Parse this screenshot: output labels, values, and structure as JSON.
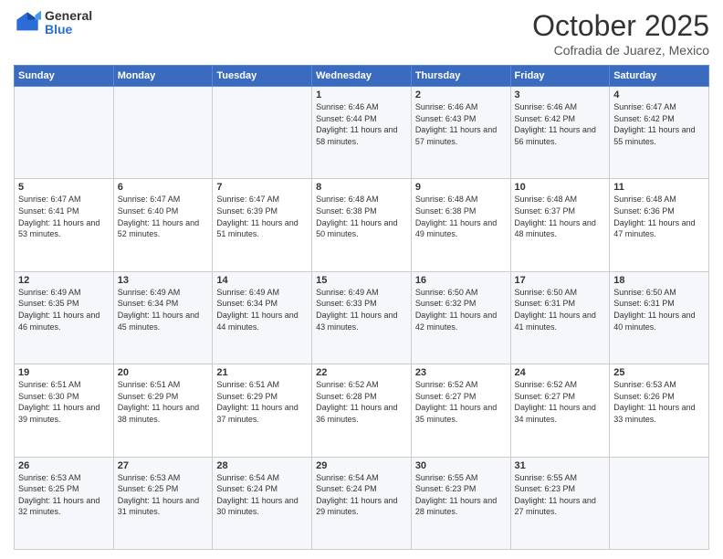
{
  "header": {
    "logo_general": "General",
    "logo_blue": "Blue",
    "month_title": "October 2025",
    "location": "Cofradia de Juarez, Mexico"
  },
  "days_of_week": [
    "Sunday",
    "Monday",
    "Tuesday",
    "Wednesday",
    "Thursday",
    "Friday",
    "Saturday"
  ],
  "weeks": [
    [
      {
        "day": "",
        "sunrise": "",
        "sunset": "",
        "daylight": ""
      },
      {
        "day": "",
        "sunrise": "",
        "sunset": "",
        "daylight": ""
      },
      {
        "day": "",
        "sunrise": "",
        "sunset": "",
        "daylight": ""
      },
      {
        "day": "1",
        "sunrise": "Sunrise: 6:46 AM",
        "sunset": "Sunset: 6:44 PM",
        "daylight": "Daylight: 11 hours and 58 minutes."
      },
      {
        "day": "2",
        "sunrise": "Sunrise: 6:46 AM",
        "sunset": "Sunset: 6:43 PM",
        "daylight": "Daylight: 11 hours and 57 minutes."
      },
      {
        "day": "3",
        "sunrise": "Sunrise: 6:46 AM",
        "sunset": "Sunset: 6:42 PM",
        "daylight": "Daylight: 11 hours and 56 minutes."
      },
      {
        "day": "4",
        "sunrise": "Sunrise: 6:47 AM",
        "sunset": "Sunset: 6:42 PM",
        "daylight": "Daylight: 11 hours and 55 minutes."
      }
    ],
    [
      {
        "day": "5",
        "sunrise": "Sunrise: 6:47 AM",
        "sunset": "Sunset: 6:41 PM",
        "daylight": "Daylight: 11 hours and 53 minutes."
      },
      {
        "day": "6",
        "sunrise": "Sunrise: 6:47 AM",
        "sunset": "Sunset: 6:40 PM",
        "daylight": "Daylight: 11 hours and 52 minutes."
      },
      {
        "day": "7",
        "sunrise": "Sunrise: 6:47 AM",
        "sunset": "Sunset: 6:39 PM",
        "daylight": "Daylight: 11 hours and 51 minutes."
      },
      {
        "day": "8",
        "sunrise": "Sunrise: 6:48 AM",
        "sunset": "Sunset: 6:38 PM",
        "daylight": "Daylight: 11 hours and 50 minutes."
      },
      {
        "day": "9",
        "sunrise": "Sunrise: 6:48 AM",
        "sunset": "Sunset: 6:38 PM",
        "daylight": "Daylight: 11 hours and 49 minutes."
      },
      {
        "day": "10",
        "sunrise": "Sunrise: 6:48 AM",
        "sunset": "Sunset: 6:37 PM",
        "daylight": "Daylight: 11 hours and 48 minutes."
      },
      {
        "day": "11",
        "sunrise": "Sunrise: 6:48 AM",
        "sunset": "Sunset: 6:36 PM",
        "daylight": "Daylight: 11 hours and 47 minutes."
      }
    ],
    [
      {
        "day": "12",
        "sunrise": "Sunrise: 6:49 AM",
        "sunset": "Sunset: 6:35 PM",
        "daylight": "Daylight: 11 hours and 46 minutes."
      },
      {
        "day": "13",
        "sunrise": "Sunrise: 6:49 AM",
        "sunset": "Sunset: 6:34 PM",
        "daylight": "Daylight: 11 hours and 45 minutes."
      },
      {
        "day": "14",
        "sunrise": "Sunrise: 6:49 AM",
        "sunset": "Sunset: 6:34 PM",
        "daylight": "Daylight: 11 hours and 44 minutes."
      },
      {
        "day": "15",
        "sunrise": "Sunrise: 6:49 AM",
        "sunset": "Sunset: 6:33 PM",
        "daylight": "Daylight: 11 hours and 43 minutes."
      },
      {
        "day": "16",
        "sunrise": "Sunrise: 6:50 AM",
        "sunset": "Sunset: 6:32 PM",
        "daylight": "Daylight: 11 hours and 42 minutes."
      },
      {
        "day": "17",
        "sunrise": "Sunrise: 6:50 AM",
        "sunset": "Sunset: 6:31 PM",
        "daylight": "Daylight: 11 hours and 41 minutes."
      },
      {
        "day": "18",
        "sunrise": "Sunrise: 6:50 AM",
        "sunset": "Sunset: 6:31 PM",
        "daylight": "Daylight: 11 hours and 40 minutes."
      }
    ],
    [
      {
        "day": "19",
        "sunrise": "Sunrise: 6:51 AM",
        "sunset": "Sunset: 6:30 PM",
        "daylight": "Daylight: 11 hours and 39 minutes."
      },
      {
        "day": "20",
        "sunrise": "Sunrise: 6:51 AM",
        "sunset": "Sunset: 6:29 PM",
        "daylight": "Daylight: 11 hours and 38 minutes."
      },
      {
        "day": "21",
        "sunrise": "Sunrise: 6:51 AM",
        "sunset": "Sunset: 6:29 PM",
        "daylight": "Daylight: 11 hours and 37 minutes."
      },
      {
        "day": "22",
        "sunrise": "Sunrise: 6:52 AM",
        "sunset": "Sunset: 6:28 PM",
        "daylight": "Daylight: 11 hours and 36 minutes."
      },
      {
        "day": "23",
        "sunrise": "Sunrise: 6:52 AM",
        "sunset": "Sunset: 6:27 PM",
        "daylight": "Daylight: 11 hours and 35 minutes."
      },
      {
        "day": "24",
        "sunrise": "Sunrise: 6:52 AM",
        "sunset": "Sunset: 6:27 PM",
        "daylight": "Daylight: 11 hours and 34 minutes."
      },
      {
        "day": "25",
        "sunrise": "Sunrise: 6:53 AM",
        "sunset": "Sunset: 6:26 PM",
        "daylight": "Daylight: 11 hours and 33 minutes."
      }
    ],
    [
      {
        "day": "26",
        "sunrise": "Sunrise: 6:53 AM",
        "sunset": "Sunset: 6:25 PM",
        "daylight": "Daylight: 11 hours and 32 minutes."
      },
      {
        "day": "27",
        "sunrise": "Sunrise: 6:53 AM",
        "sunset": "Sunset: 6:25 PM",
        "daylight": "Daylight: 11 hours and 31 minutes."
      },
      {
        "day": "28",
        "sunrise": "Sunrise: 6:54 AM",
        "sunset": "Sunset: 6:24 PM",
        "daylight": "Daylight: 11 hours and 30 minutes."
      },
      {
        "day": "29",
        "sunrise": "Sunrise: 6:54 AM",
        "sunset": "Sunset: 6:24 PM",
        "daylight": "Daylight: 11 hours and 29 minutes."
      },
      {
        "day": "30",
        "sunrise": "Sunrise: 6:55 AM",
        "sunset": "Sunset: 6:23 PM",
        "daylight": "Daylight: 11 hours and 28 minutes."
      },
      {
        "day": "31",
        "sunrise": "Sunrise: 6:55 AM",
        "sunset": "Sunset: 6:23 PM",
        "daylight": "Daylight: 11 hours and 27 minutes."
      },
      {
        "day": "",
        "sunrise": "",
        "sunset": "",
        "daylight": ""
      }
    ]
  ]
}
